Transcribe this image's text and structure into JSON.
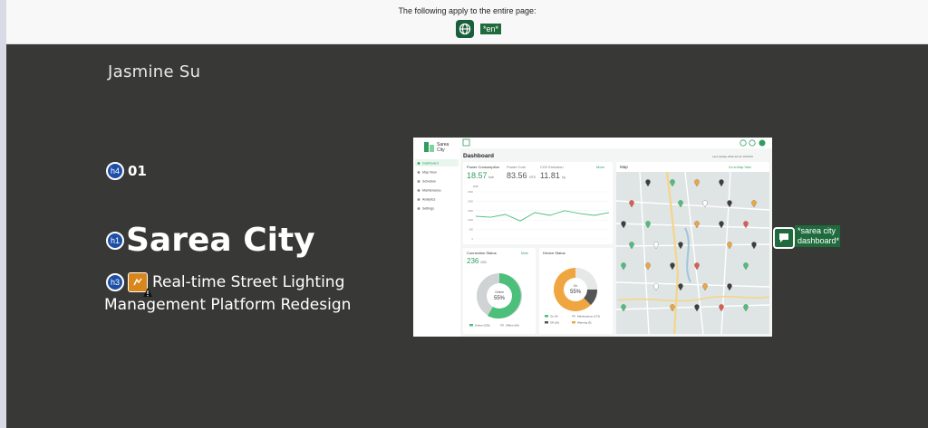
{
  "notice": {
    "text": "The following apply to the entire page:",
    "language_badge": "*en*"
  },
  "hero": {
    "author": "Jasmine Su",
    "h4_badge": "h4",
    "h4_text": "01",
    "h1_badge": "h1",
    "title": "Sarea City",
    "h3_badge": "h3",
    "h3_line1": "Real-time Street Lighting",
    "h3_line2": "Management Platform Redesign",
    "image_comment": "*sarea city dashboard*"
  },
  "dashboard": {
    "logo_line1": "Sarea",
    "logo_line2": "City",
    "page_title": "Dashboard",
    "last_update": "Last Update 2022-10-31 13:09:50",
    "nav": [
      "Dashboard",
      "Map View",
      "Schedule",
      "Maintenance",
      "Analytics",
      "Settings"
    ],
    "power": {
      "tabs": [
        "Power Consumption",
        "Power Cost",
        "CO2 Emission"
      ],
      "values": [
        "18.57",
        "83.56",
        "11.81"
      ],
      "units": [
        "kwh",
        "NTD",
        "kg"
      ],
      "more": "More",
      "unit_label": "kWh",
      "yticks": [
        "2500",
        "2000",
        "1500",
        "1000",
        "500",
        "0"
      ],
      "series": [
        1200,
        1150,
        1300,
        950,
        1400,
        1250,
        1500,
        1350,
        1250,
        1400
      ],
      "ymax": 2500
    },
    "map": {
      "title": "Map",
      "link": "Go to Map View"
    },
    "connection": {
      "title": "Connection Status",
      "value": "236",
      "unit": "/300",
      "more": "More",
      "center_label": "Online",
      "percent": "55%",
      "legend": [
        "Online (236)",
        "Offline (64)"
      ]
    },
    "device": {
      "title": "Device Status",
      "center_label": "On",
      "percent": "55%",
      "legend": [
        "On (4)",
        "Maintenance (173)",
        "Off (10)",
        "Warning (5)"
      ]
    }
  },
  "colors": {
    "accent": "#1f6b3d",
    "hero_bg": "#383937",
    "dash_green": "#4cc07a",
    "dash_orange": "#f0a640"
  }
}
